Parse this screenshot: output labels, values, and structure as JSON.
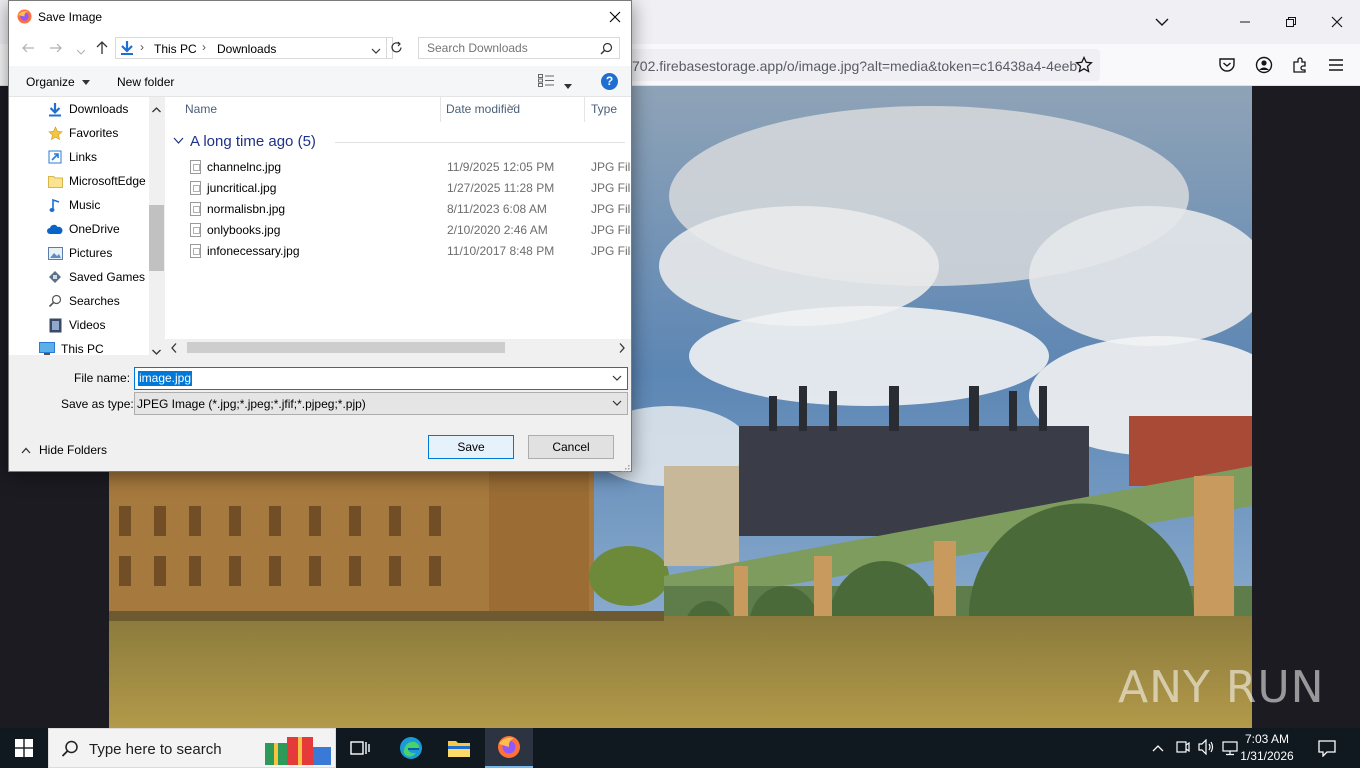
{
  "browser": {
    "url_visible": "702.firebasestorage.app/o/image.jpg?alt=media&token=c16438a4-4eeb",
    "window_controls": [
      "list-all-tabs-icon",
      "minimize-icon",
      "restore-icon",
      "close-icon"
    ]
  },
  "dialog": {
    "title": "Save Image",
    "path": [
      "This PC",
      "Downloads"
    ],
    "search_placeholder": "Search Downloads",
    "organize_label": "Organize",
    "new_folder_label": "New folder",
    "nav_items": [
      {
        "label": "Downloads",
        "icon": "download-icon"
      },
      {
        "label": "Favorites",
        "icon": "star-icon"
      },
      {
        "label": "Links",
        "icon": "link-icon"
      },
      {
        "label": "MicrosoftEdge",
        "icon": "folder-icon"
      },
      {
        "label": "Music",
        "icon": "music-icon"
      },
      {
        "label": "OneDrive",
        "icon": "cloud-icon"
      },
      {
        "label": "Pictures",
        "icon": "pictures-icon"
      },
      {
        "label": "Saved Games",
        "icon": "games-icon"
      },
      {
        "label": "Searches",
        "icon": "search-icon"
      },
      {
        "label": "Videos",
        "icon": "videos-icon"
      },
      {
        "label": "This PC",
        "icon": "computer-icon"
      }
    ],
    "columns": {
      "name": "Name",
      "date": "Date modified",
      "type": "Type"
    },
    "group_header": "A long time ago (5)",
    "files": [
      {
        "name": "channelnc.jpg",
        "date": "11/9/2025 12:05 PM",
        "type": "JPG File"
      },
      {
        "name": "juncritical.jpg",
        "date": "1/27/2025 11:28 PM",
        "type": "JPG File"
      },
      {
        "name": "normalisbn.jpg",
        "date": "8/11/2023 6:08 AM",
        "type": "JPG File"
      },
      {
        "name": "onlybooks.jpg",
        "date": "2/10/2020 2:46 AM",
        "type": "JPG File"
      },
      {
        "name": "infonecessary.jpg",
        "date": "11/10/2017 8:48 PM",
        "type": "JPG File"
      }
    ],
    "file_name_label": "File name:",
    "file_name_value": "image.jpg",
    "save_type_label": "Save as type:",
    "save_type_value": "JPEG Image (*.jpg;*.jpeg;*.jfif;*.pjpeg;*.pjp)",
    "hide_folders_label": "Hide Folders",
    "save_label": "Save",
    "cancel_label": "Cancel"
  },
  "taskbar": {
    "search_placeholder": "Type here to search",
    "time": "7:03 AM",
    "date": "1/31/2026"
  },
  "watermark": "ANY RUN",
  "colors": {
    "accent": "#0078d7",
    "taskbar": "#101820",
    "firefox_toolbar": "#f9f9fb"
  }
}
